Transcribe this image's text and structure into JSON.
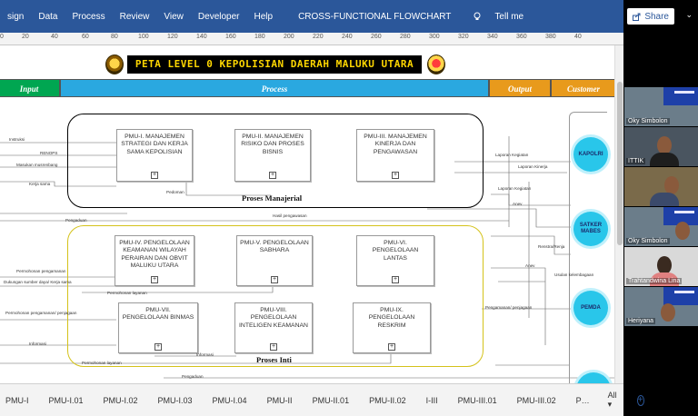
{
  "ribbon": {
    "tabs": [
      "sign",
      "Data",
      "Process",
      "Review",
      "View",
      "Developer",
      "Help"
    ],
    "doc_title": "CROSS-FUNCTIONAL FLOWCHART",
    "tell_me": "Tell me",
    "share": "Share"
  },
  "ruler": {
    "ticks": [
      "0",
      "20",
      "40",
      "60",
      "80",
      "100",
      "120",
      "140",
      "160",
      "180",
      "200",
      "220",
      "240",
      "260",
      "280",
      "300",
      "320",
      "340",
      "360",
      "380",
      "40"
    ]
  },
  "diagram": {
    "title": "PETA LEVEL 0 KEPOLISIAN DAERAH MALUKU UTARA",
    "lanes": {
      "input": "Input",
      "process": "Process",
      "output": "Output",
      "customer": "Customer"
    },
    "group_managerial": "Proses Manajerial",
    "group_core": "Proses Inti",
    "boxes": {
      "pmu1": "PMU-I. MANAJEMEN STRATEGI DAN KERJA SAMA KEPOLISIAN",
      "pmu2": "PMU-II. MANAJEMEN RISIKO DAN PROSES BISNIS",
      "pmu3": "PMU-III. MANAJEMEN KINERJA DAN PENGAWASAN",
      "pmu4": "PMU-IV. PENGELOLAAN KEAMANAN WILAYAH PERAIRAN DAN OBVIT MALUKU UTARA",
      "pmu5": "PMU-V. PENGELOLAAN SABHARA",
      "pmu6": "PMU-VI. PENGELOLAAN LANTAS",
      "pmu7": "PMU-VII. PENGELOLAAN BINMAS",
      "pmu8": "PMU-VIII. PENGELOLAAN INTELIGEN KEAMANAN",
      "pmu9": "PMU-IX. PENGELOLAAN RESKRIM"
    },
    "customers": {
      "kapolri": "KAPOLRI",
      "satker": "SATKER MABES",
      "pemda": "PEMDA"
    },
    "labels": {
      "instruksi": "Instruksi",
      "renops": "RENOPS",
      "musrenbang": "Masukan musrenbang",
      "kerjasama": "Kerja sama",
      "pedoman": "Pedoman",
      "hasil_pengawasan": "Hasil pengawasan",
      "pengaduan_1": "Pengaduan",
      "lap_kegiatan_1": "Laporan Kegiatan",
      "lap_kinerja": "Laporan Kinerja",
      "lap_kegiatan_2": "Laporan Kegiatan",
      "anev_1": "Anev",
      "renstra": "Renstra/Renja",
      "anev_2": "Anev",
      "usulan": "Usulan kelembagaan",
      "permohonan_pengamanan": "Permohonan pengamanan",
      "dukungan": "Dukungan sumber daya/ Kerja sama",
      "permohonan_layanan_1": "Permohonan layanan",
      "permohonan_pp": "Permohonan pengamanan/ penjagaan",
      "informasi_1": "Informasi",
      "informasi_2": "Informasi",
      "permohonan_layanan_2": "Permohonan layanan",
      "pengamanan": "Pengamanan/ penjagaan",
      "pengaduan_2": "Pengaduan"
    }
  },
  "sheet_tabs": [
    "PMU-I",
    "PMU-I.01",
    "PMU-I.02",
    "PMU-I.03",
    "PMU-I.04",
    "PMU-II",
    "PMU-II.01",
    "PMU-II.02",
    "I-III",
    "PMU-III.01",
    "PMU-III.02",
    "P…"
  ],
  "sheet_all": "All",
  "participants": [
    "Oky Simbolon",
    "ITTIK",
    "",
    "Oky Simbolon",
    "Trahtandwina Lina",
    "Heriyana"
  ],
  "colors": {
    "ribbon": "#2b579a",
    "lane_input": "#00a651",
    "lane_process": "#2aa8e0",
    "lane_output": "#e89a1c",
    "customer": "#29c6ea",
    "group_core_border": "#d4c21a",
    "title_bg": "#000000",
    "title_text": "#ffd700"
  }
}
